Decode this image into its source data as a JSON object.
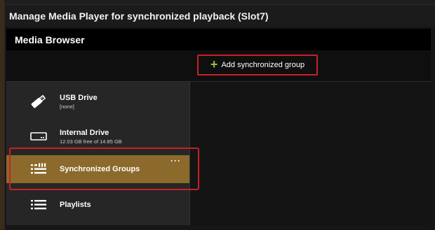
{
  "window": {
    "title": "Manage Media Player for synchronized playback (Slot7)"
  },
  "section": {
    "title": "Media Browser"
  },
  "toolbar": {
    "add_group_label": "Add synchronized group",
    "add_group_icon": "plus-icon",
    "accent_color": "#8cc63f"
  },
  "sidebar": {
    "items": [
      {
        "label": "USB Drive",
        "sub": "[none]",
        "icon": "usb-drive-icon"
      },
      {
        "label": "Internal Drive",
        "sub": "12.03 GB free of 14.85 GB",
        "icon": "internal-drive-icon"
      },
      {
        "label": "Synchronized Groups",
        "sub": "",
        "icon": "synchronized-groups-icon",
        "selected": true,
        "menu": "···"
      },
      {
        "label": "Playlists",
        "sub": "",
        "icon": "playlists-icon"
      }
    ]
  },
  "colors": {
    "selected_bg": "#8c6a2c",
    "highlight_border": "#c8202a"
  }
}
